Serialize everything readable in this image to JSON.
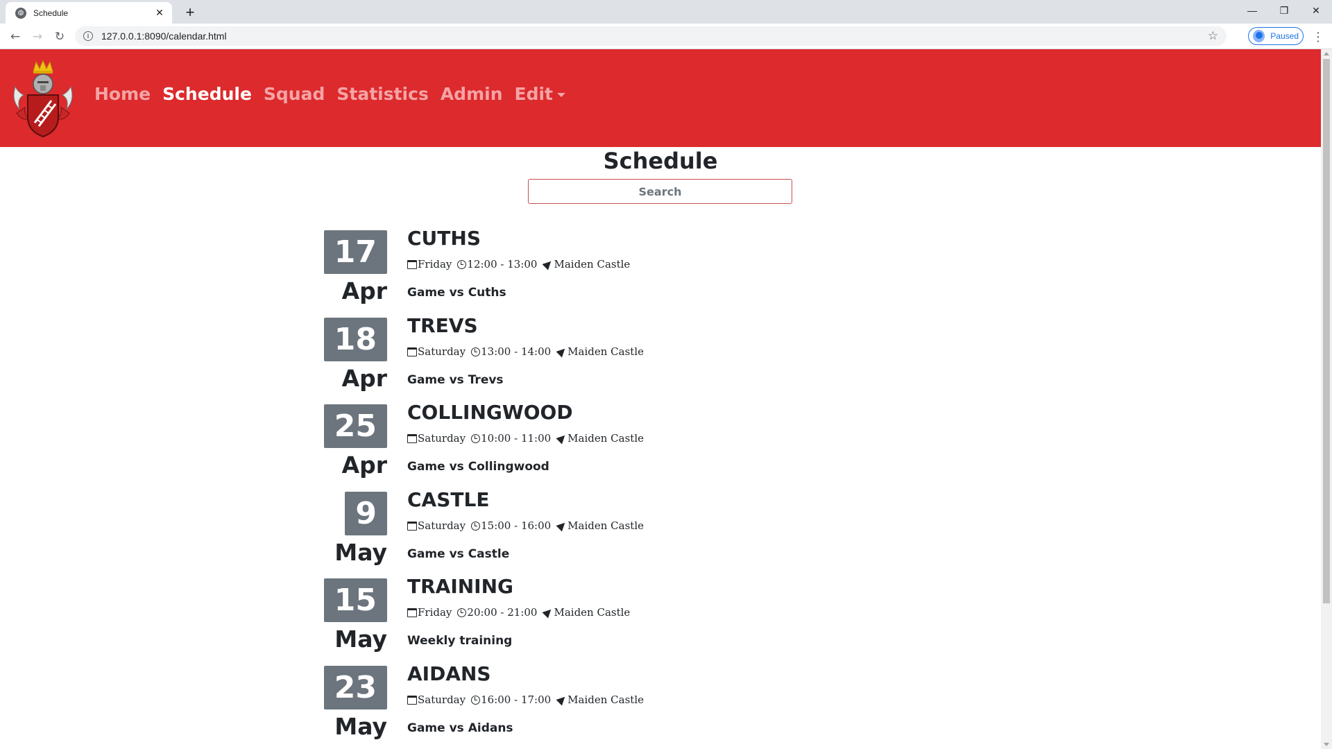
{
  "browser": {
    "tab_title": "Schedule",
    "tab_close": "✕",
    "new_tab": "+",
    "url": "127.0.0.1:8090/calendar.html",
    "profile_status": "Paused",
    "window_controls": {
      "minimize": "—",
      "restore": "❐",
      "close": "✕"
    }
  },
  "nav": {
    "links": [
      {
        "label": "Home",
        "active": false
      },
      {
        "label": "Schedule",
        "active": true
      },
      {
        "label": "Squad",
        "active": false
      },
      {
        "label": "Statistics",
        "active": false
      },
      {
        "label": "Admin",
        "active": false
      },
      {
        "label": "Edit",
        "active": false
      }
    ]
  },
  "page": {
    "title": "Schedule",
    "search_placeholder": "Search"
  },
  "events": [
    {
      "day": "17",
      "month": "Apr",
      "title": "CUTHS",
      "weekday": "Friday",
      "time": "12:00 - 13:00",
      "location": "Maiden Castle",
      "description": "Game vs Cuths"
    },
    {
      "day": "18",
      "month": "Apr",
      "title": "TREVS",
      "weekday": "Saturday",
      "time": "13:00 - 14:00",
      "location": "Maiden Castle",
      "description": "Game vs Trevs"
    },
    {
      "day": "25",
      "month": "Apr",
      "title": "COLLINGWOOD",
      "weekday": "Saturday",
      "time": "10:00 - 11:00",
      "location": "Maiden Castle",
      "description": "Game vs Collingwood"
    },
    {
      "day": "9",
      "month": "May",
      "title": "CASTLE",
      "weekday": "Saturday",
      "time": "15:00 - 16:00",
      "location": "Maiden Castle",
      "description": "Game vs Castle"
    },
    {
      "day": "15",
      "month": "May",
      "title": "TRAINING",
      "weekday": "Friday",
      "time": "20:00 - 21:00",
      "location": "Maiden Castle",
      "description": "Weekly training"
    },
    {
      "day": "23",
      "month": "May",
      "title": "AIDANS",
      "weekday": "Saturday",
      "time": "16:00 - 17:00",
      "location": "Maiden Castle",
      "description": "Game vs Aidans"
    }
  ],
  "colors": {
    "navbar": "#dc2a2d",
    "nav_link_inactive": "#f4a4a5",
    "nav_link_active": "#ffffff",
    "date_badge": "#6c757d",
    "search_border": "#c94d4f"
  }
}
